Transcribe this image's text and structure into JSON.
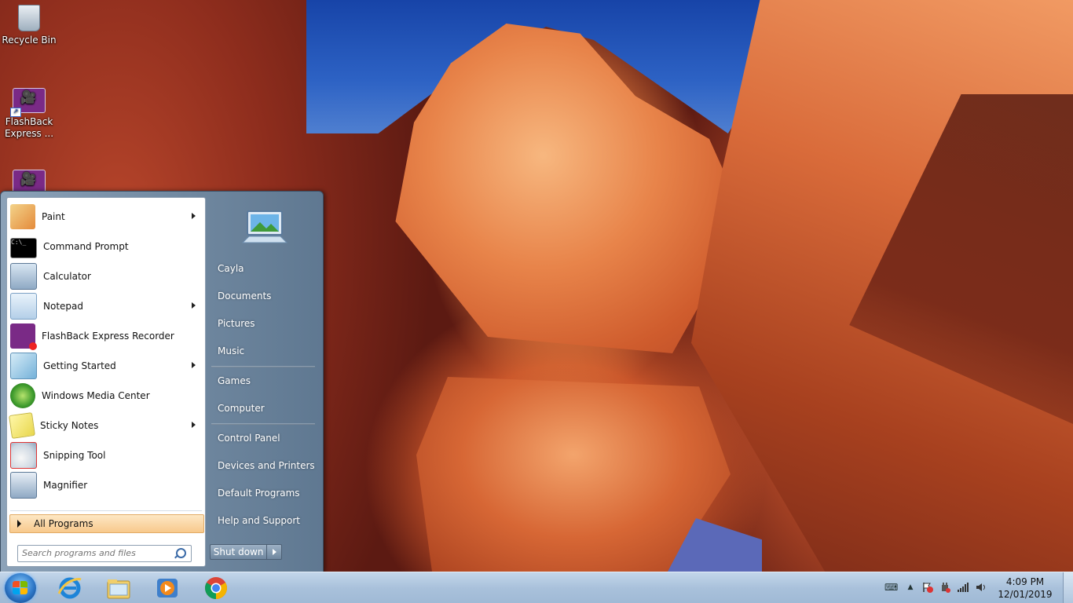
{
  "desktop": {
    "icons": [
      {
        "label": "Recycle Bin",
        "icon": "recycle-bin-icon"
      },
      {
        "label": "FlashBack\nExpress ...",
        "icon": "flashback-player-icon"
      },
      {
        "label": "",
        "icon": "flashback-recorder-icon"
      }
    ]
  },
  "start_menu": {
    "programs": [
      {
        "label": "Paint",
        "icon": "paint-icon",
        "has_submenu": true
      },
      {
        "label": "Command Prompt",
        "icon": "command-prompt-icon",
        "has_submenu": false
      },
      {
        "label": "Calculator",
        "icon": "calculator-icon",
        "has_submenu": false
      },
      {
        "label": "Notepad",
        "icon": "notepad-icon",
        "has_submenu": true
      },
      {
        "label": "FlashBack Express Recorder",
        "icon": "flashback-recorder-icon",
        "has_submenu": false
      },
      {
        "label": "Getting Started",
        "icon": "getting-started-icon",
        "has_submenu": true
      },
      {
        "label": "Windows Media Center",
        "icon": "windows-media-center-icon",
        "has_submenu": false
      },
      {
        "label": "Sticky Notes",
        "icon": "sticky-notes-icon",
        "has_submenu": true
      },
      {
        "label": "Snipping Tool",
        "icon": "snipping-tool-icon",
        "has_submenu": false
      },
      {
        "label": "Magnifier",
        "icon": "magnifier-icon",
        "has_submenu": false
      }
    ],
    "all_programs_label": "All Programs",
    "search_placeholder": "Search programs and files",
    "right_links": {
      "user": "Cayla",
      "documents": "Documents",
      "pictures": "Pictures",
      "music": "Music",
      "games": "Games",
      "computer": "Computer",
      "control_panel": "Control Panel",
      "devices_printers": "Devices and Printers",
      "default_programs": "Default Programs",
      "help_support": "Help and Support"
    },
    "shutdown_label": "Shut down"
  },
  "taskbar": {
    "pinned": [
      "internet-explorer-icon",
      "windows-explorer-icon",
      "windows-media-player-icon",
      "google-chrome-icon"
    ],
    "tray_icons": [
      "keyboard-icon",
      "show-hidden-icons-chevron",
      "action-center-flag-icon",
      "power-plug-icon",
      "network-signal-icon",
      "volume-icon"
    ],
    "time": "4:09 PM",
    "date": "12/01/2019"
  },
  "colors": {
    "taskbar": "#a9c1db",
    "start_menu_right": "#6f879f",
    "all_programs_highlight": "#f8c98c"
  }
}
